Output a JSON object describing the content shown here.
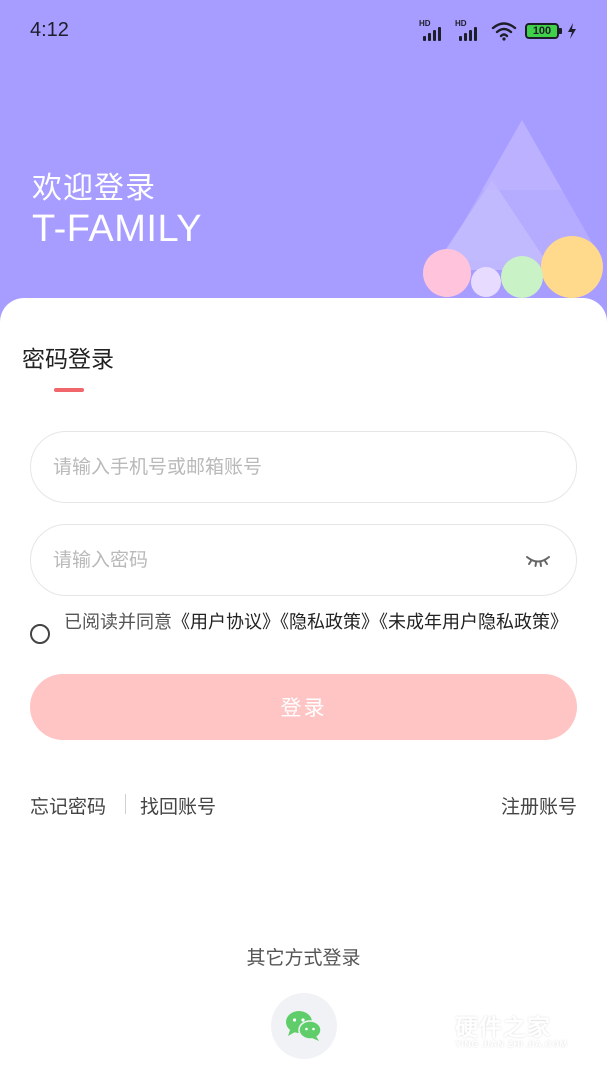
{
  "status_bar": {
    "time": "4:12",
    "battery": "100",
    "network_label": "HD",
    "icons": [
      "signal-icon",
      "signal-icon",
      "wifi-icon",
      "battery-icon",
      "charging-bolt-icon"
    ]
  },
  "header": {
    "welcome": "欢迎登录",
    "brand": "T-FAMILY",
    "background_color": "#a79cff"
  },
  "login": {
    "tab_title": "密码登录",
    "phone_placeholder": "请输入手机号或邮箱账号",
    "phone_value": "",
    "password_placeholder": "请输入密码",
    "password_value": "",
    "agreement": {
      "prefix": "已阅读并同意",
      "user_agreement": "《用户协议》",
      "privacy_policy": "《隐私政策》",
      "minor_privacy_policy": "《未成年用户隐私政策》",
      "checked": false
    },
    "submit_label": "登录",
    "submit_color": "#ffc5c5",
    "accent_color": "#f0666a"
  },
  "links": {
    "forgot_password": "忘记密码",
    "recover_account": "找回账号",
    "register": "注册账号"
  },
  "other_login": {
    "title": "其它方式登录",
    "methods": [
      "wechat-icon"
    ]
  },
  "watermark": {
    "text": "硬件之家",
    "subtext": "YING JIAN ZHI JIA.COM"
  }
}
